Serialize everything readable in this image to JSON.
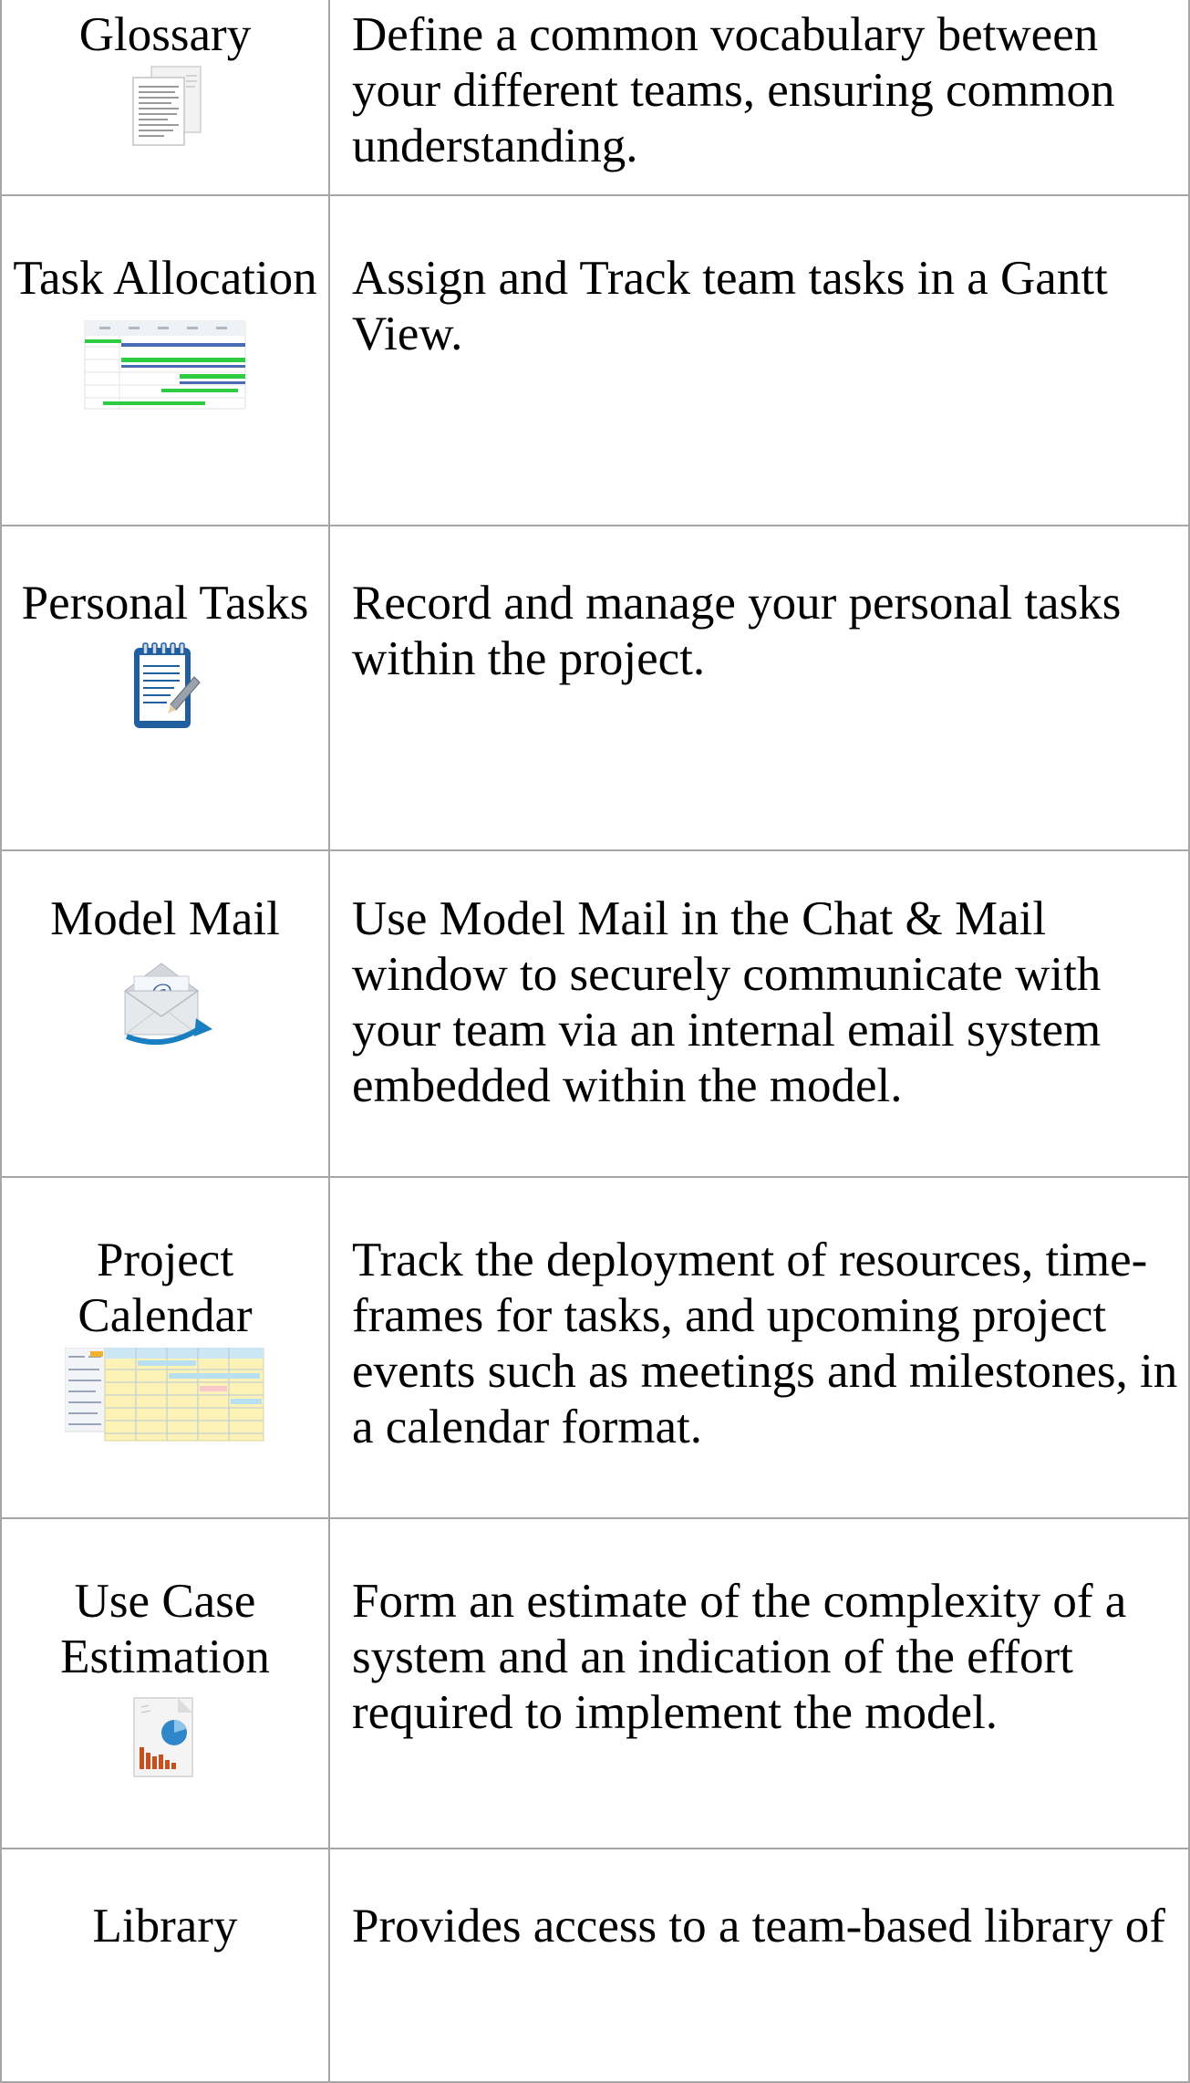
{
  "rows": [
    {
      "name": "Glossary",
      "icon": "glossary-document-icon",
      "description": "Define a common vocabulary between your different teams, ensuring common understanding."
    },
    {
      "name": "Task Allocation",
      "icon": "gantt-chart-icon",
      "description": "Assign and Track team tasks in a Gantt View."
    },
    {
      "name": "Personal Tasks",
      "icon": "notepad-pencil-icon",
      "description": "Record and manage your personal tasks within the project."
    },
    {
      "name": "Model Mail",
      "icon": "mail-envelope-icon",
      "description": "Use Model Mail in the Chat & Mail window to securely communicate with your team via an internal email system embedded within the model."
    },
    {
      "name": "Project Calendar",
      "icon": "calendar-grid-icon",
      "description": "Track the deployment of resources, time-frames for tasks, and upcoming project events such as meetings and milestones, in a calendar format."
    },
    {
      "name": "Use Case Estimation",
      "icon": "estimation-chart-icon",
      "description": "Form an estimate of the complexity of a system and an indication of the effort required to implement the model."
    },
    {
      "name": "Library",
      "icon": "",
      "description": "Provides access to a team-based library of"
    }
  ],
  "colors": {
    "border": "#a6a6a6",
    "gantt_green": "#2ecc40",
    "gantt_blue": "#4a6bb3",
    "notepad_blue": "#1f5fa0",
    "mail_arrow": "#1a7fc1",
    "calendar_yellow": "#fdf3b6",
    "chart_orange": "#c8501e",
    "chart_blue": "#2f86c8"
  }
}
